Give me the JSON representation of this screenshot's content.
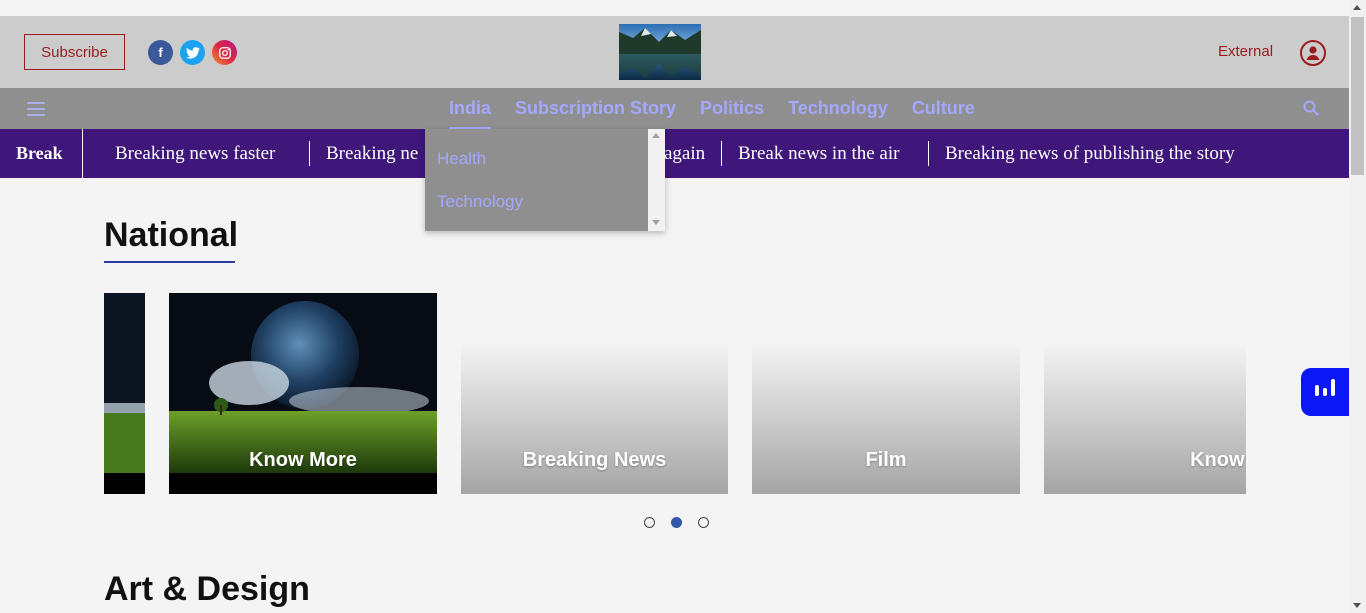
{
  "header": {
    "subscribe_label": "Subscribe",
    "external_label": "External",
    "social": [
      "facebook-icon",
      "twitter-icon",
      "instagram-icon"
    ],
    "accent_color": "#9b1c1c"
  },
  "nav": {
    "items": [
      {
        "label": "India",
        "active": true
      },
      {
        "label": "Subscription Story"
      },
      {
        "label": "Politics"
      },
      {
        "label": "Technology"
      },
      {
        "label": "Culture"
      }
    ],
    "link_color": "#a4a8ff"
  },
  "dropdown": {
    "items": [
      "Health",
      "Technology"
    ]
  },
  "ticker": {
    "label": "Break",
    "items": [
      "Breaking news faster",
      "Breaking ne",
      "again",
      "Break news in the air",
      "Breaking news of publishing the story"
    ],
    "background": "#3f1679"
  },
  "sections": {
    "national": "National",
    "art_design": "Art & Design"
  },
  "carousel": {
    "cards": [
      "Know More",
      "Breaking News",
      "Film",
      "Know More"
    ],
    "dots": 3,
    "active_dot": 2
  }
}
